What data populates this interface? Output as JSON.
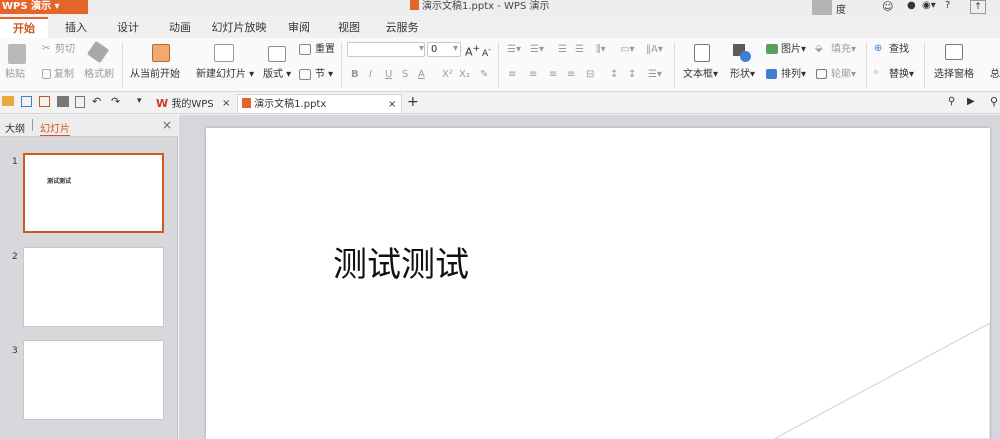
{
  "app": {
    "menu_label": "WPS 演示",
    "window_title": "演示文稿1.pptx - WPS 演示",
    "user_name": "度无小鸟",
    "help": "?"
  },
  "tabs": [
    "开始",
    "插入",
    "设计",
    "动画",
    "幻灯片放映",
    "审阅",
    "视图",
    "云服务"
  ],
  "ribbon": {
    "paste": "粘贴",
    "cut": "剪切",
    "copy": "复制",
    "format_painter": "格式刷",
    "from_current": "从当前开始",
    "new_slide": "新建幻灯片",
    "layout": "版式",
    "section": "节",
    "reset": "重置",
    "font_size": "0",
    "font_buttons": [
      "B",
      "I",
      "U",
      "S",
      "A",
      "X²",
      "X₂"
    ],
    "textbox": "文本框",
    "shape": "形状",
    "picture": "图片",
    "fill": "填充",
    "arrange": "排列",
    "outline": "轮廓",
    "find": "查找",
    "replace": "替换",
    "selection_pane": "选择窗格",
    "more": "总"
  },
  "doc_tabs": [
    {
      "label": "我的WPS",
      "close": "×"
    },
    {
      "label": "演示文稿1.pptx",
      "close": "×"
    }
  ],
  "new_tab": "+",
  "pane": {
    "outline_tab": "大纲",
    "slides_tab": "幻灯片",
    "close": "×"
  },
  "slides": [
    {
      "number": "1",
      "text": "测试测试"
    },
    {
      "number": "2",
      "text": ""
    },
    {
      "number": "3",
      "text": ""
    }
  ],
  "current_slide": {
    "text": "测试测试"
  },
  "colors": {
    "accent": "#e4652a",
    "workspace": "#d6d7dc"
  }
}
